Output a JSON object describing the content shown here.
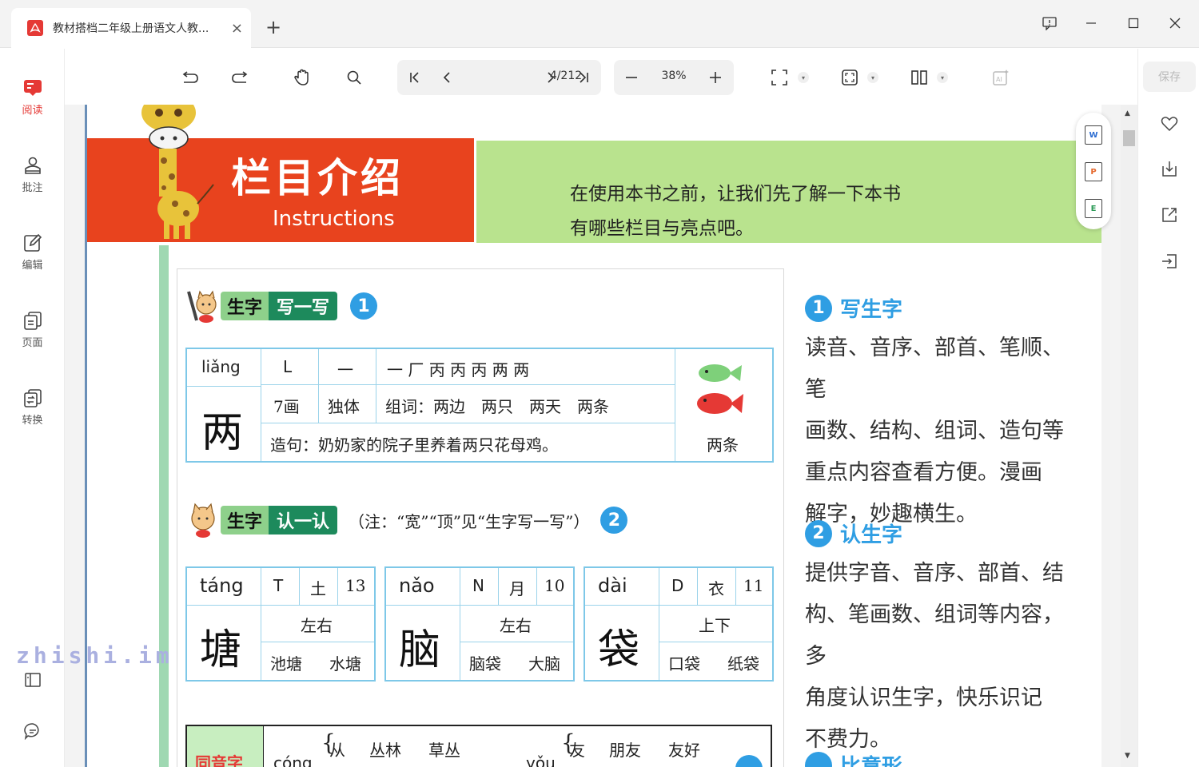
{
  "titlebar": {
    "tab_title": "教材搭档二年级上册语文人教...",
    "tab_badge": "PDF",
    "new_tab": "+",
    "close": "×"
  },
  "leftbar": {
    "items": [
      {
        "label": "阅读",
        "icon": "read-icon",
        "active": true
      },
      {
        "label": "批注",
        "icon": "annotate-icon"
      },
      {
        "label": "编辑",
        "icon": "edit-icon"
      },
      {
        "label": "页面",
        "icon": "pages-icon"
      },
      {
        "label": "转换",
        "icon": "convert-icon"
      }
    ]
  },
  "toolbar": {
    "page_indicator": "4/212",
    "zoom": "38%"
  },
  "rightbar": {
    "save_label": "保存"
  },
  "page": {
    "banner_title": "栏目介绍",
    "banner_subtitle": "Instructions",
    "banner_line1": "在使用本书之前，让我们先了解一下本书",
    "banner_line2": "有哪些栏目与亮点吧。",
    "section1": {
      "tag1": "生字",
      "tag2": "写一写",
      "number": "1",
      "pinyin": "liǎng",
      "letter": "L",
      "radical": "一",
      "strokes_order": "一 厂 丙 丙 丙 两 两",
      "char": "两",
      "stroke_count": "7画",
      "structure": "独体",
      "words": "组词：两边　两只　两天　两条",
      "sentence": "造句：奶奶家的院子里养着两只花母鸡。",
      "pic_caption": "两条"
    },
    "section2": {
      "tag1": "生字",
      "tag2": "认一认",
      "note": "（注：“宽”“顶”见“生字写一写”）",
      "number": "2",
      "cards": [
        {
          "pinyin": "táng",
          "letter": "T",
          "radical": "土",
          "strokes": "13",
          "char": "塘",
          "structure": "左右",
          "w1": "池塘",
          "w2": "水塘"
        },
        {
          "pinyin": "nǎo",
          "letter": "N",
          "radical": "月",
          "strokes": "10",
          "char": "脑",
          "structure": "左右",
          "w1": "脑袋",
          "w2": "大脑"
        },
        {
          "pinyin": "dài",
          "letter": "D",
          "radical": "衣",
          "strokes": "11",
          "char": "袋",
          "structure": "上下",
          "w1": "口袋",
          "w2": "纸袋"
        }
      ]
    },
    "section3": {
      "tag": "同音字",
      "p1": "cóng",
      "w1a": "从",
      "w1b": "丛林",
      "w1c": "草丛",
      "p2": "yǒu",
      "w2a": "友",
      "w2b": "朋友",
      "w2c": "友好"
    },
    "right_col": {
      "h1_num": "1",
      "h1": "写生字",
      "b1": [
        "读音、音序、部首、笔顺、笔",
        "画数、结构、组词、造句等",
        "重点内容查看方便。漫画",
        "解字，妙趣横生。"
      ],
      "h2_num": "2",
      "h2": "认生字",
      "b2": [
        "提供字音、音序、部首、结",
        "构、笔画数、组词等内容，多",
        "角度认识生字，快乐识记",
        "不费力。"
      ],
      "h3": "比意形"
    }
  },
  "floatbar": {
    "icons": [
      "W",
      "P",
      "E"
    ]
  },
  "watermark": "zhishi.im",
  "colors": {
    "accent": "#e53935",
    "orange": "#e8431e",
    "green": "#b9e38e",
    "blue": "#2f9ee3"
  }
}
